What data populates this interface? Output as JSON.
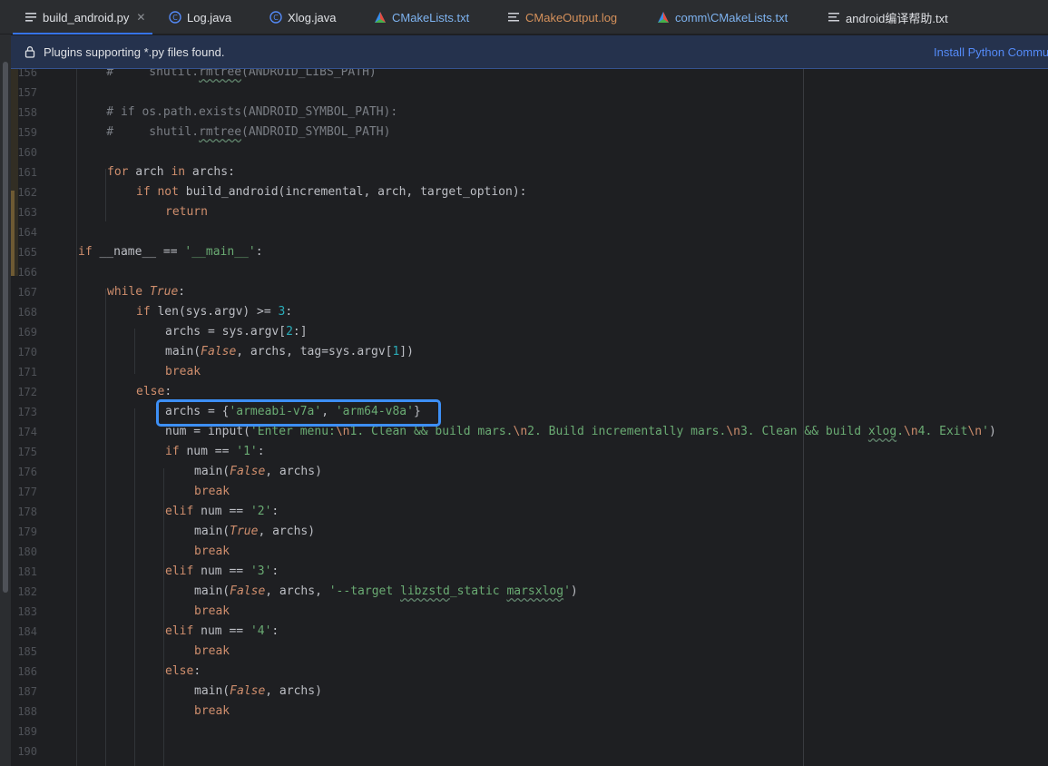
{
  "tabs": [
    {
      "label": "build_android.py",
      "icon": "python-file-icon",
      "active": true
    },
    {
      "label": "Log.java",
      "icon": "java-class-icon"
    },
    {
      "label": "Xlog.java",
      "icon": "java-class-icon"
    },
    {
      "label": "CMakeLists.txt",
      "icon": "cmake-icon"
    },
    {
      "label": "CMakeOutput.log",
      "icon": "text-file-icon"
    },
    {
      "label": "comm\\CMakeLists.txt",
      "icon": "cmake-icon"
    },
    {
      "label": "android编译帮助.txt",
      "icon": "text-file-icon"
    }
  ],
  "banner": {
    "message": "Plugins supporting *.py files found.",
    "action": "Install Python Commu"
  },
  "line_numbers": [
    "156",
    "157",
    "158",
    "159",
    "160",
    "161",
    "162",
    "163",
    "164",
    "165",
    "166",
    "167",
    "168",
    "169",
    "170",
    "171",
    "172",
    "173",
    "174",
    "175",
    "176",
    "177",
    "178",
    "179",
    "180",
    "181",
    "182",
    "183",
    "184",
    "185",
    "186",
    "187",
    "188",
    "189",
    "190"
  ],
  "colors": {
    "accent": "#3574f0",
    "highlight_box": "#3d8ff5",
    "keyword": "#cf8e6d",
    "string": "#6aab73",
    "number": "#2aacb8",
    "comment": "#7a7e85"
  },
  "code": {
    "l156": {
      "t0": "    #     shutil.",
      "t1": "rmtree",
      "t2": "(ANDROID_LIBS_PATH)"
    },
    "l158": {
      "t0": "    # if os.path.exists(ANDROID_SYMBOL_PATH):"
    },
    "l159": {
      "t0": "    #     shutil.",
      "t1": "rmtree",
      "t2": "(ANDROID_SYMBOL_PATH)"
    },
    "l161": {
      "t0": "for",
      "t1": " arch ",
      "t2": "in",
      "t3": " archs:"
    },
    "l162": {
      "t0": "if not",
      "t1": " build_android(incremental, arch, target_option):"
    },
    "l163": {
      "t0": "return"
    },
    "l165": {
      "t0": "if",
      "t1": " __name__ == ",
      "t2": "'__main__'",
      "t3": ":"
    },
    "l167": {
      "t0": "while",
      "t1": "True",
      "t2": ":"
    },
    "l168": {
      "t0": "if",
      "t1": " len(sys.argv) >= ",
      "t2": "3",
      "t3": ":"
    },
    "l169": {
      "t0": "archs = sys.argv[",
      "t1": "2",
      "t2": ":]"
    },
    "l170": {
      "t0": "main(",
      "t1": "False",
      "t2": ", archs, tag=sys.argv[",
      "t3": "1",
      "t4": "])"
    },
    "l171": {
      "t0": "break"
    },
    "l172": {
      "t0": "else",
      "t1": ":"
    },
    "l173": {
      "t0": "archs = {",
      "t1": "'armeabi-v7a'",
      "t2": ", ",
      "t3": "'arm64-v8a'",
      "t4": "}"
    },
    "l174": {
      "t0": "num = input(",
      "t1": "'Enter menu:",
      "t2": "\\n",
      "t3": "1. Clean && build mars.",
      "t4": "\\n",
      "t5": "2. Build incrementally mars.",
      "t6": "\\n",
      "t7": "3. Clean && build ",
      "t8": "xlog",
      "t9": ".",
      "t10": "\\n",
      "t11": "4. Exit",
      "t12": "\\n",
      "t13": "'",
      "t14": ")"
    },
    "l175": {
      "t0": "if",
      "t1": " num == ",
      "t2": "'1'",
      "t3": ":"
    },
    "l176": {
      "t0": "main(",
      "t1": "False",
      "t2": ", archs)"
    },
    "l177": {
      "t0": "break"
    },
    "l178": {
      "t0": "elif",
      "t1": " num == ",
      "t2": "'2'",
      "t3": ":"
    },
    "l179": {
      "t0": "main(",
      "t1": "True",
      "t2": ", archs)"
    },
    "l180": {
      "t0": "break"
    },
    "l181": {
      "t0": "elif",
      "t1": " num == ",
      "t2": "'3'",
      "t3": ":"
    },
    "l182": {
      "t0": "main(",
      "t1": "False",
      "t2": ", archs, ",
      "t3": "'--target ",
      "t4": "libzstd",
      "t5": "_static ",
      "t6": "marsxlog",
      "t7": "'",
      "t8": ")"
    },
    "l183": {
      "t0": "break"
    },
    "l184": {
      "t0": "elif",
      "t1": " num == ",
      "t2": "'4'",
      "t3": ":"
    },
    "l185": {
      "t0": "break"
    },
    "l186": {
      "t0": "else",
      "t1": ":"
    },
    "l187": {
      "t0": "main(",
      "t1": "False",
      "t2": ", archs)"
    },
    "l188": {
      "t0": "break"
    }
  }
}
